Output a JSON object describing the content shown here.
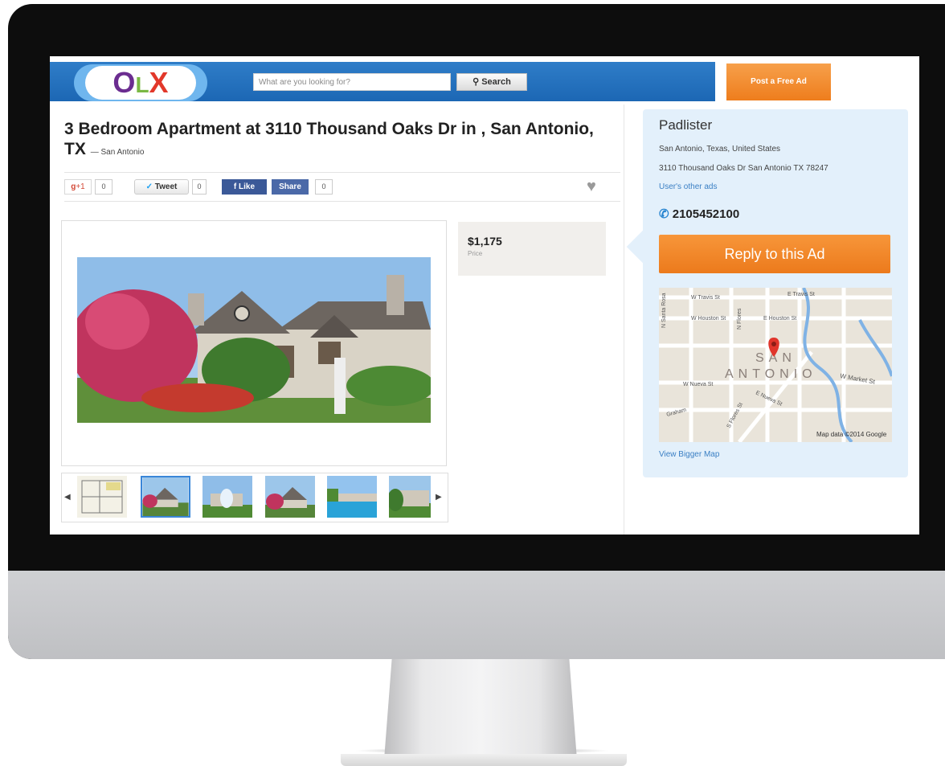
{
  "header": {
    "logo": "OLX",
    "search_placeholder": "What are you looking for?",
    "search_button": "Search",
    "post_button": "Post a Free Ad"
  },
  "listing": {
    "title": "3 Bedroom Apartment at 3110 Thousand Oaks Dr in , San Antonio, TX",
    "location_suffix": "— San Antonio",
    "price": "$1,175",
    "price_label": "Price"
  },
  "social": {
    "gplus_label": "+1",
    "gplus_count": "0",
    "tweet_label": "Tweet",
    "tweet_count": "0",
    "like_label": "Like",
    "share_label": "Share",
    "share_count": "0"
  },
  "seller": {
    "name": "Padlister",
    "region": "San Antonio, Texas, United States",
    "address": "3110 Thousand Oaks Dr San Antonio TX 78247",
    "other_ads": "User's other ads",
    "phone": "2105452100",
    "reply_button": "Reply to this Ad"
  },
  "map": {
    "city_line1": "SAN",
    "city_line2": "ANTONIO",
    "streets": [
      "W Travis St",
      "E Travis St",
      "W Houston St",
      "E Houston St",
      "N Santa Rosa",
      "N Flores",
      "W Market St",
      "W Nueva St",
      "E Nueva St",
      "S Flores St",
      "Graham"
    ],
    "attribution": "Map data ©2014 Google",
    "view_bigger": "View Bigger Map"
  },
  "colors": {
    "header_blue": "#1f6fbd",
    "orange": "#ee7d1d",
    "panel_blue": "#e3f0fb",
    "link": "#3a7fc4"
  }
}
